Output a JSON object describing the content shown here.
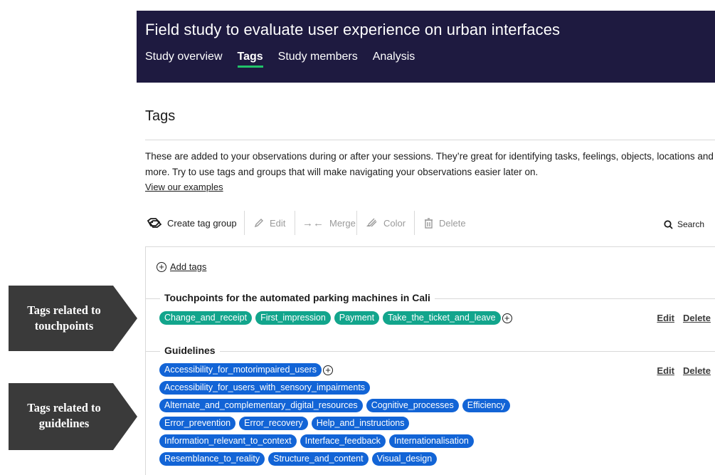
{
  "header": {
    "title": "Field study to evaluate user experience on urban interfaces",
    "tabs": [
      {
        "label": "Study overview"
      },
      {
        "label": "Tags"
      },
      {
        "label": "Study members"
      },
      {
        "label": "Analysis"
      }
    ],
    "active_tab": "Tags",
    "accent_color": "#22c36a",
    "background_color": "#1e1a40"
  },
  "main": {
    "title": "Tags",
    "description": "These are added to your observations during or after your sessions. They’re great for identifying tasks, feelings, objects, locations and more. Try to use tags and groups that will make navigating your observations easier later on.",
    "examples_link": "View our examples"
  },
  "toolbar": {
    "create_label": "Create tag group",
    "edit_label": "Edit",
    "merge_label": "Merge",
    "color_label": "Color",
    "delete_label": "Delete",
    "search_label": "Search",
    "icons": [
      "tags-icon",
      "pencil-icon",
      "merge-icon",
      "brush-icon",
      "trash-icon",
      "search-icon"
    ]
  },
  "panel": {
    "add_tags_label": "Add tags",
    "groups": [
      {
        "title": "Touchpoints for the automated parking machines in Cali",
        "color": "#12a58c",
        "edit_label": "Edit",
        "delete_label": "Delete",
        "tags": [
          "Change_and_receipt",
          "First_impression",
          "Payment",
          "Take_the_ticket_and_leave"
        ]
      },
      {
        "title": "Guidelines",
        "color": "#1264d6",
        "edit_label": "Edit",
        "delete_label": "Delete",
        "tags": [
          "Accessibility_for_motorimpaired_users",
          "Accessibility_for_users_with_sensory_impairments",
          "Alternate_and_complementary_digital_resources",
          "Cognitive_processes",
          "Efficiency",
          "Error_prevention",
          "Error_recovery",
          "Help_and_instructions",
          "Information_relevant_to_context",
          "Interface_feedback",
          "Internationalisation",
          "Resemblance_to_reality",
          "Structure_and_content",
          "Visual_design"
        ]
      }
    ]
  },
  "annotations": [
    {
      "text": "Tags related to touchpoints"
    },
    {
      "text": "Tags related to guidelines"
    }
  ],
  "annotation_color": "#3a3a3a"
}
